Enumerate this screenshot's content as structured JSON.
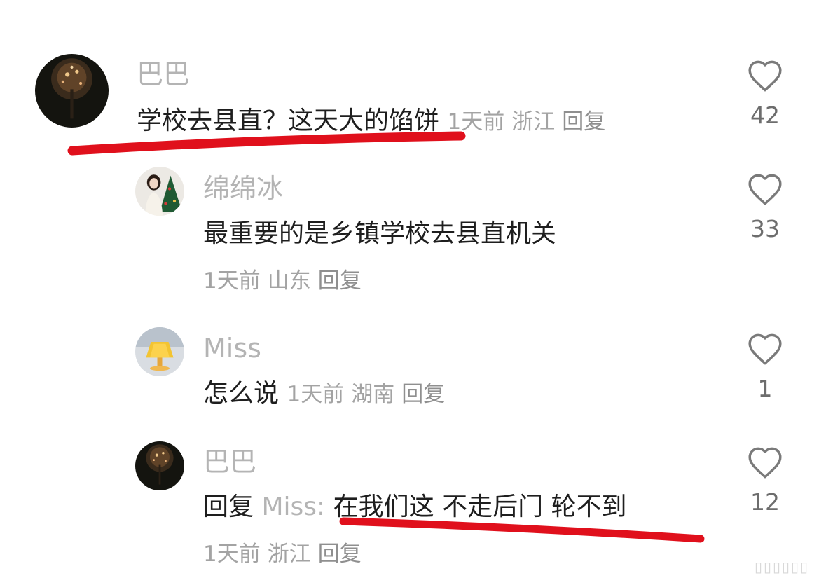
{
  "comments": [
    {
      "user": "巴巴",
      "text": "学校去县直？这天大的馅饼",
      "time": "1天前",
      "region": "浙江",
      "reply_label": "回复",
      "likes": "42"
    },
    {
      "user": "绵绵冰",
      "text": "最重要的是乡镇学校去县直机关",
      "time": "1天前",
      "region": "山东",
      "reply_label": "回复",
      "likes": "33"
    },
    {
      "user": "Miss",
      "text": "怎么说",
      "time": "1天前",
      "region": "湖南",
      "reply_label": "回复",
      "likes": "1"
    },
    {
      "user": "巴巴",
      "reply_prefix": "回复",
      "reply_target": "Miss:",
      "text": "在我们这 不走后门 轮不到",
      "time": "1天前",
      "region": "浙江",
      "reply_label": "回复",
      "likes": "12"
    }
  ],
  "colors": {
    "underline": "#e0101c",
    "name": "#b4b4b4",
    "meta": "#a3a3a3",
    "text": "#1e1e1e"
  },
  "icons": {
    "like": "heart-outline-icon"
  }
}
